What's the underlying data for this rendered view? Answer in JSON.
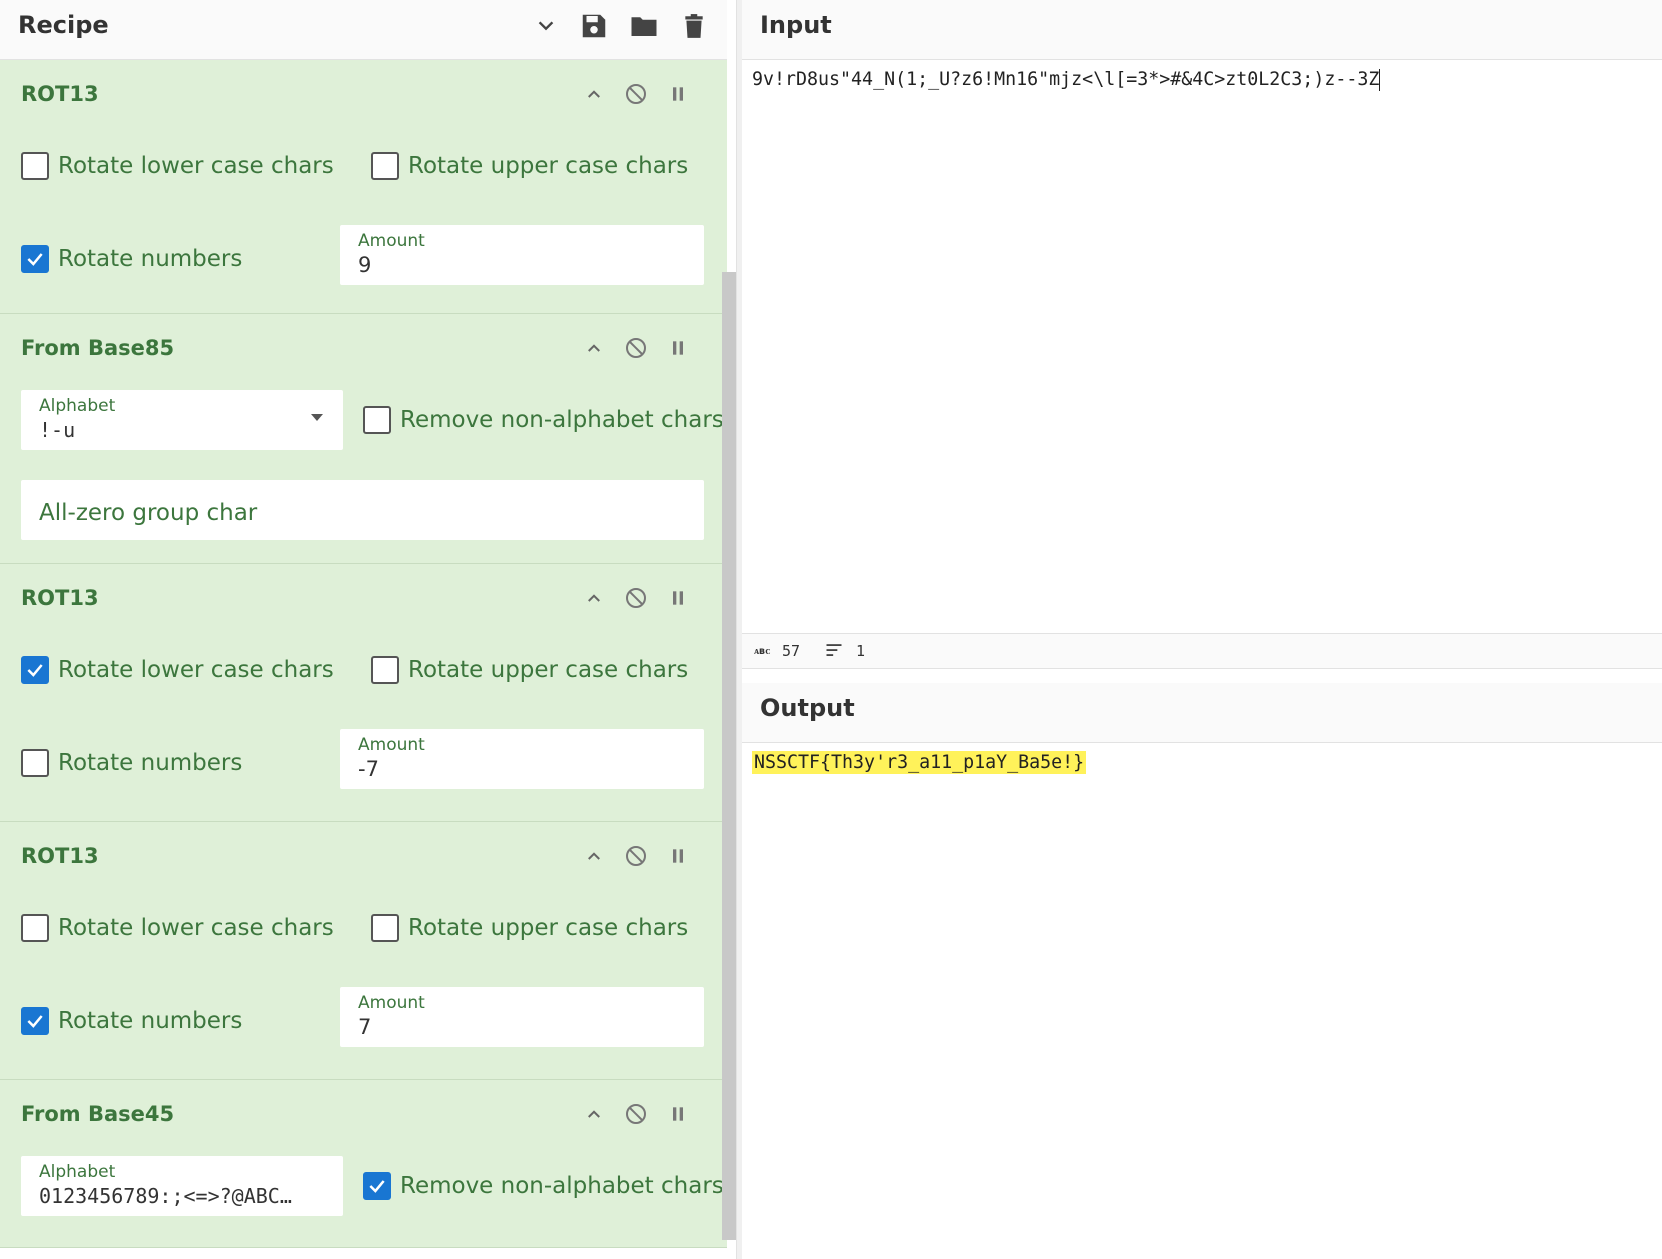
{
  "recipe": {
    "title": "Recipe",
    "operations": [
      {
        "name": "ROT13",
        "checkboxes": [
          {
            "label": "Rotate lower case chars",
            "checked": false
          },
          {
            "label": "Rotate upper case chars",
            "checked": false
          },
          {
            "label": "Rotate numbers",
            "checked": true
          }
        ],
        "amount_label": "Amount",
        "amount_value": "9"
      },
      {
        "name": "From Base85",
        "alphabet_label": "Alphabet",
        "alphabet_value": "!-u",
        "remove_label": "Remove non-alphabet chars",
        "remove_checked": false,
        "allzero_placeholder": "All-zero group char"
      },
      {
        "name": "ROT13",
        "checkboxes": [
          {
            "label": "Rotate lower case chars",
            "checked": true
          },
          {
            "label": "Rotate upper case chars",
            "checked": false
          },
          {
            "label": "Rotate numbers",
            "checked": false
          }
        ],
        "amount_label": "Amount",
        "amount_value": "-7"
      },
      {
        "name": "ROT13",
        "checkboxes": [
          {
            "label": "Rotate lower case chars",
            "checked": false
          },
          {
            "label": "Rotate upper case chars",
            "checked": false
          },
          {
            "label": "Rotate numbers",
            "checked": true
          }
        ],
        "amount_label": "Amount",
        "amount_value": "7"
      },
      {
        "name": "From Base45",
        "alphabet_label": "Alphabet",
        "alphabet_value": "0123456789:;<=>?@ABC…",
        "remove_label": "Remove non-alphabet chars",
        "remove_checked": true
      }
    ]
  },
  "input": {
    "title": "Input",
    "text": "9v!rD8us\"44_N(1;_U?z6!Mn16\"mjz<\\l[=3*>#&4C>zt0L2C3;)z--3Z",
    "length": "57",
    "lines": "1"
  },
  "output": {
    "title": "Output",
    "text": "NSSCTF{Th3y'r3_a11_p1aY_Ba5e!}"
  },
  "colors": {
    "op_bg": "#dff0d8",
    "op_text": "#3c763d",
    "checkbox_on": "#1976d2",
    "highlight": "#fff25a"
  }
}
